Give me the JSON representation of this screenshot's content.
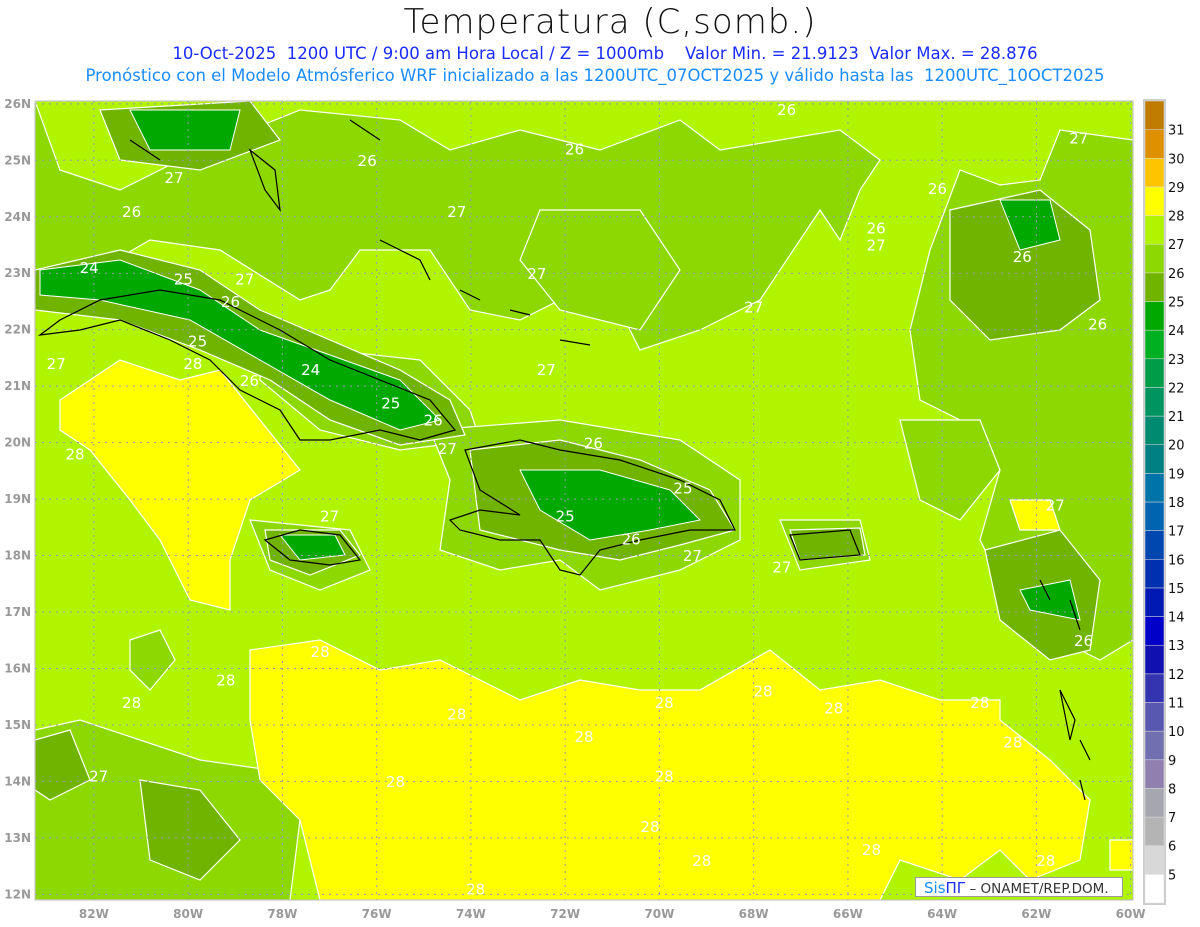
{
  "header": {
    "title": "Temperatura (C,somb.)",
    "subtitle_1": "10-Oct-2025  1200 UTC / 9:00 am Hora Local / Z = 1000mb    Valor Min. = 21.9123  Valor Max. = 28.876",
    "subtitle_2": "Pronóstico con el Modelo Atmósferico WRF inicializado a las 1200UTC_07OCT2025 y válido hasta las  1200UTC_10OCT2025"
  },
  "map": {
    "lon_range": [
      -83.25,
      -59.95
    ],
    "lat_range": [
      11.9,
      26.05
    ],
    "lat_labels": [
      "12N",
      "13N",
      "14N",
      "15N",
      "16N",
      "17N",
      "18N",
      "19N",
      "20N",
      "21N",
      "22N",
      "23N",
      "24N",
      "25N",
      "26N"
    ],
    "lon_labels": [
      "82W",
      "80W",
      "78W",
      "76W",
      "74W",
      "72W",
      "70W",
      "68W",
      "66W",
      "64W",
      "62W",
      "60W"
    ],
    "contour_labels": [
      {
        "t": "26",
        "lon": -81.2,
        "lat": 24.0
      },
      {
        "t": "27",
        "lon": -80.3,
        "lat": 24.6
      },
      {
        "t": "26",
        "lon": -76.2,
        "lat": 24.9
      },
      {
        "t": "27",
        "lon": -74.3,
        "lat": 24.0
      },
      {
        "t": "26",
        "lon": -71.8,
        "lat": 25.1
      },
      {
        "t": "26",
        "lon": -67.3,
        "lat": 25.8
      },
      {
        "t": "24",
        "lon": -82.1,
        "lat": 23.0
      },
      {
        "t": "25",
        "lon": -80.1,
        "lat": 22.8
      },
      {
        "t": "26",
        "lon": -79.1,
        "lat": 22.4
      },
      {
        "t": "27",
        "lon": -78.8,
        "lat": 22.8
      },
      {
        "t": "27",
        "lon": -72.6,
        "lat": 22.9
      },
      {
        "t": "27",
        "lon": -68.0,
        "lat": 22.3
      },
      {
        "t": "26",
        "lon": -65.4,
        "lat": 23.7
      },
      {
        "t": "27",
        "lon": -65.4,
        "lat": 23.4
      },
      {
        "t": "26",
        "lon": -64.1,
        "lat": 24.4
      },
      {
        "t": "26",
        "lon": -62.3,
        "lat": 23.2
      },
      {
        "t": "27",
        "lon": -61.1,
        "lat": 25.3
      },
      {
        "t": "26",
        "lon": -60.7,
        "lat": 22.0
      },
      {
        "t": "27",
        "lon": -82.8,
        "lat": 21.3
      },
      {
        "t": "25",
        "lon": -79.8,
        "lat": 21.7
      },
      {
        "t": "28",
        "lon": -79.9,
        "lat": 21.3
      },
      {
        "t": "26",
        "lon": -78.7,
        "lat": 21.0
      },
      {
        "t": "24",
        "lon": -77.4,
        "lat": 21.2
      },
      {
        "t": "25",
        "lon": -75.7,
        "lat": 20.6
      },
      {
        "t": "26",
        "lon": -74.8,
        "lat": 20.3
      },
      {
        "t": "27",
        "lon": -74.5,
        "lat": 19.8
      },
      {
        "t": "27",
        "lon": -72.4,
        "lat": 21.2
      },
      {
        "t": "26",
        "lon": -71.4,
        "lat": 19.9
      },
      {
        "t": "25",
        "lon": -69.5,
        "lat": 19.1
      },
      {
        "t": "25",
        "lon": -72.0,
        "lat": 18.6
      },
      {
        "t": "26",
        "lon": -70.6,
        "lat": 18.2
      },
      {
        "t": "27",
        "lon": -69.3,
        "lat": 17.9
      },
      {
        "t": "27",
        "lon": -67.4,
        "lat": 17.7
      },
      {
        "t": "27",
        "lon": -77.0,
        "lat": 18.6
      },
      {
        "t": "28",
        "lon": -82.4,
        "lat": 19.7
      },
      {
        "t": "27",
        "lon": -61.6,
        "lat": 18.8
      },
      {
        "t": "26",
        "lon": -61.0,
        "lat": 16.4
      },
      {
        "t": "28",
        "lon": -79.2,
        "lat": 15.7
      },
      {
        "t": "28",
        "lon": -81.2,
        "lat": 15.3
      },
      {
        "t": "28",
        "lon": -77.2,
        "lat": 16.2
      },
      {
        "t": "28",
        "lon": -74.3,
        "lat": 15.1
      },
      {
        "t": "28",
        "lon": -71.6,
        "lat": 14.7
      },
      {
        "t": "28",
        "lon": -69.9,
        "lat": 15.3
      },
      {
        "t": "28",
        "lon": -67.8,
        "lat": 15.5
      },
      {
        "t": "28",
        "lon": -66.3,
        "lat": 15.2
      },
      {
        "t": "28",
        "lon": -63.2,
        "lat": 15.3
      },
      {
        "t": "28",
        "lon": -62.5,
        "lat": 14.6
      },
      {
        "t": "28",
        "lon": -69.9,
        "lat": 14.0
      },
      {
        "t": "27",
        "lon": -81.9,
        "lat": 14.0
      },
      {
        "t": "28",
        "lon": -75.6,
        "lat": 13.9
      },
      {
        "t": "28",
        "lon": -70.2,
        "lat": 13.1
      },
      {
        "t": "28",
        "lon": -69.1,
        "lat": 12.5
      },
      {
        "t": "28",
        "lon": -65.5,
        "lat": 12.7
      },
      {
        "t": "28",
        "lon": -61.8,
        "lat": 12.5
      },
      {
        "t": "28",
        "lon": -73.9,
        "lat": 12.0
      }
    ]
  },
  "colorbar": {
    "labels": [
      "5",
      "6",
      "7",
      "8",
      "9",
      "10",
      "11",
      "12",
      "13",
      "14",
      "15",
      "16",
      "17",
      "18",
      "19",
      "20",
      "21",
      "22",
      "23",
      "24",
      "25",
      "26",
      "27",
      "28",
      "29",
      "30",
      "31"
    ],
    "colors": [
      "#ffffff",
      "#d8d8d8",
      "#b4b4b4",
      "#a6a6ae",
      "#9080b0",
      "#7070b0",
      "#5858b0",
      "#3434b0",
      "#1010b0",
      "#0000c8",
      "#0018b4",
      "#0030b0",
      "#0048b0",
      "#0064b0",
      "#0074a8",
      "#008080",
      "#008a70",
      "#009460",
      "#009c48",
      "#00b020",
      "#00a800",
      "#70b400",
      "#8cd800",
      "#b0f400",
      "#ffff00",
      "#ffc400",
      "#de9000",
      "#bf7c00"
    ]
  },
  "credit": {
    "sis": "Sis",
    "pi": "ΠΓ",
    "rest": " – ONAMET/REP.DOM."
  }
}
